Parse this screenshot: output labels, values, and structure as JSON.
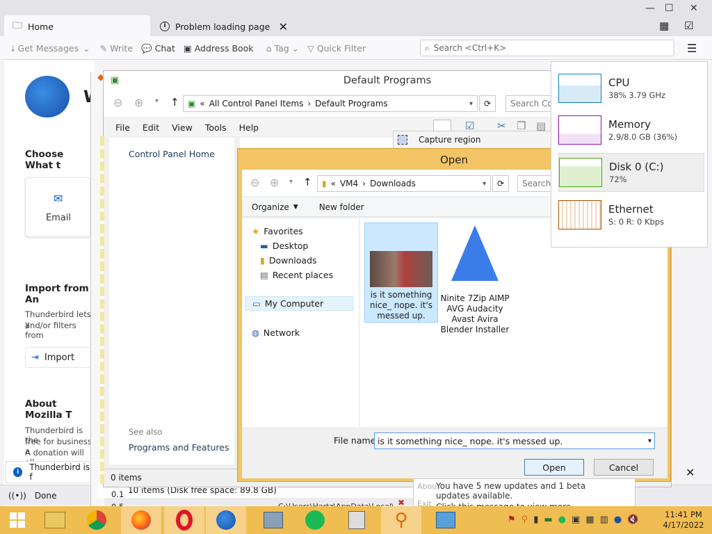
{
  "thunderbird": {
    "tabs": [
      {
        "label": "Home"
      },
      {
        "label": "Problem loading page"
      }
    ],
    "toolbar": {
      "get_messages": "Get Messages",
      "write": "Write",
      "chat": "Chat",
      "address_book": "Address Book",
      "tag": "Tag",
      "quick_filter": "Quick Filter",
      "search_placeholder": "Search <Ctrl+K>"
    },
    "body": {
      "logo_letter": "W",
      "choose_heading": "Choose What t",
      "email_label": "Email",
      "import_heading": "Import from An",
      "import_text_1": "Thunderbird lets y",
      "import_text_2": "and/or filters from",
      "import_button": "Import",
      "about_heading": "About Mozilla T",
      "about_text_1": "Thunderbird is the",
      "about_text_2": "free for business a",
      "about_text_3": "A donation will all",
      "notice_text": "Thunderbird is f"
    },
    "status": {
      "text": "Done"
    }
  },
  "default_programs": {
    "title": "Default Programs",
    "breadcrumb": {
      "prefix": "«",
      "part1": "All Control Panel Items",
      "sep": "›",
      "part2": "Default Programs"
    },
    "search_placeholder": "Search Con",
    "menu": [
      "File",
      "Edit",
      "View",
      "Tools",
      "Help"
    ],
    "left": {
      "home": "Control Panel Home",
      "see_also": "See also",
      "programs_features": "Programs and Features"
    },
    "status": "0 items",
    "behind_status": "10 items (Disk free space: 89.8 GB)",
    "behind_path": "C:\\Users\\Hartz\\AppData\\Local\\",
    "behind_item_1": "0.1",
    "behind_item_2": "0.5"
  },
  "open_dialog": {
    "title": "Open",
    "address": {
      "prefix": "«",
      "part1": "VM4",
      "sep": "›",
      "part2": "Downloads"
    },
    "search_placeholder": "Search",
    "organize": "Organize",
    "new_folder": "New folder",
    "nav": {
      "favorites": "Favorites",
      "desktop": "Desktop",
      "downloads": "Downloads",
      "recent": "Recent places",
      "my_computer": "My Computer",
      "network": "Network"
    },
    "files": [
      {
        "name": "is it something nice_ nope. it's messed up."
      },
      {
        "name": "Ninite 7Zip AIMP AVG Audacity Avast Avira Blender Installer"
      }
    ],
    "file_name_label": "File name:",
    "file_name_value": "is it something nice_ nope. it's messed up.",
    "open_button": "Open",
    "cancel_button": "Cancel"
  },
  "capture_menu": {
    "label": "Capture region"
  },
  "performance": {
    "cpu": {
      "name": "CPU",
      "value": "38% 3.79 GHz",
      "color": "#117dbb"
    },
    "memory": {
      "name": "Memory",
      "value": "2.9/8.0 GB (36%)",
      "color": "#8b12ae"
    },
    "disk": {
      "name": "Disk 0 (C:)",
      "value": "72%",
      "color": "#4da60c"
    },
    "ethernet": {
      "name": "Ethernet",
      "value": "S: 0 R: 0 Kbps",
      "color": "#a74f01"
    }
  },
  "notification": {
    "line1": "You have 5 new updates and 1 beta updates available.",
    "line2": "Click this message to view more.",
    "behind_1": "Abou",
    "behind_2": "Exit"
  },
  "clock": {
    "time": "11:41 PM",
    "date": "4/17/2022"
  }
}
